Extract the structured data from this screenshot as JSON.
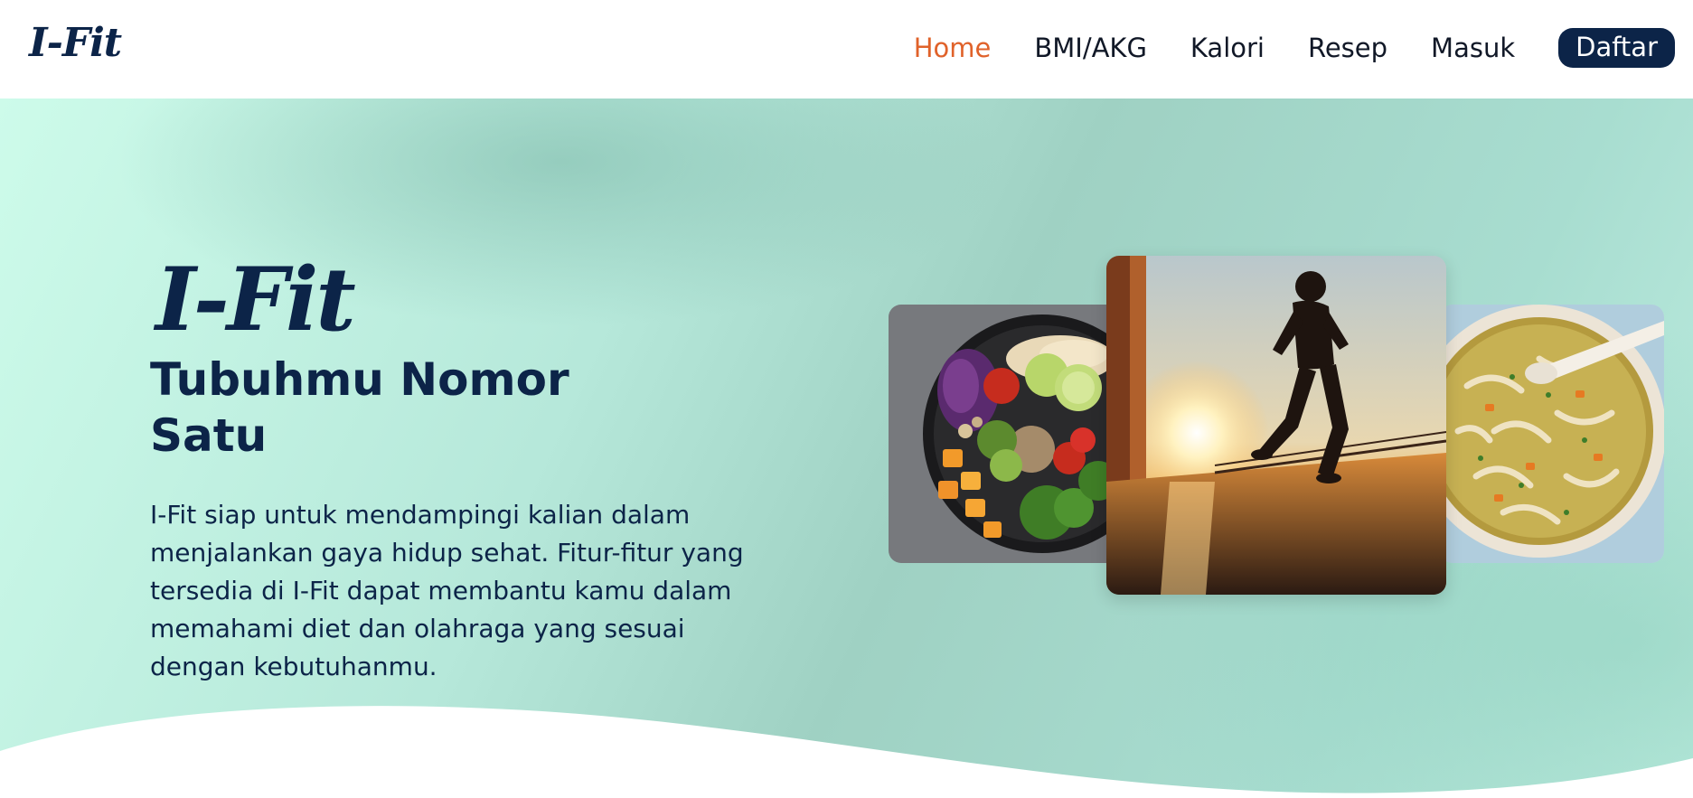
{
  "header": {
    "logo": "I-Fit",
    "nav": [
      {
        "label": "Home",
        "active": true
      },
      {
        "label": "BMI/AKG",
        "active": false
      },
      {
        "label": "Kalori",
        "active": false
      },
      {
        "label": "Resep",
        "active": false
      },
      {
        "label": "Masuk",
        "active": false
      }
    ],
    "signup_label": "Daftar"
  },
  "hero": {
    "brand": "I-Fit",
    "title": "Tubuhmu Nomor Satu",
    "description": "I-Fit siap untuk mendampingi kalian dalam menjalankan gaya hidup sehat. Fitur-fitur yang tersedia di I-Fit dapat membantu kamu dalam memahami diet dan olahraga yang sesuai dengan kebutuhanmu.",
    "images": [
      {
        "icon": "salad-bowl-image"
      },
      {
        "icon": "runner-sunrise-image"
      },
      {
        "icon": "noodle-soup-pot-image"
      }
    ]
  },
  "colors": {
    "brand_navy": "#0c2448",
    "active_link": "#e0622a",
    "hero_mint": "#b6e8da"
  }
}
